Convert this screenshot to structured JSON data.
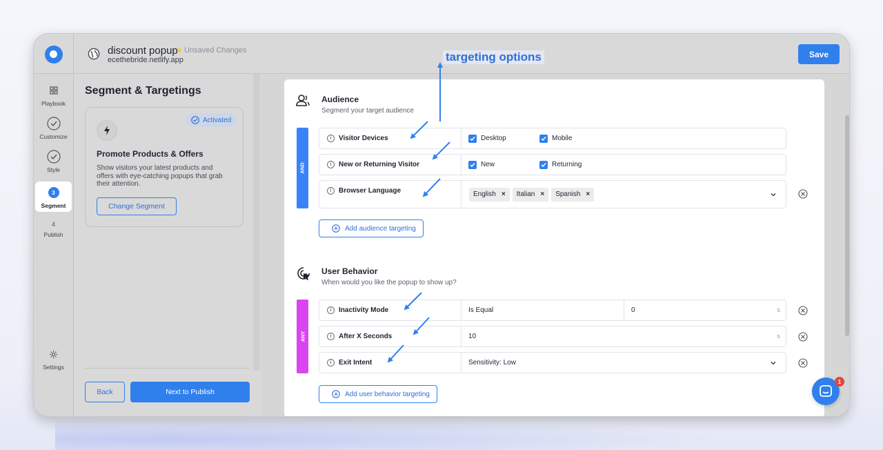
{
  "header": {
    "popup_name": "discount popup",
    "unsaved": "Unsaved Changes",
    "domain": "ecethebride.netlify.app",
    "save_label": "Save"
  },
  "nav": {
    "items": [
      {
        "label": "Playbook",
        "icon": "grid-icon"
      },
      {
        "label": "Customize",
        "icon": "check-circle-icon"
      },
      {
        "label": "Style",
        "icon": "check-circle-icon"
      },
      {
        "label": "Segment",
        "step": "3",
        "active": true
      },
      {
        "label": "Publish",
        "step": "4"
      }
    ],
    "settings_label": "Settings"
  },
  "panel": {
    "title": "Segment & Targetings",
    "badge": "Activated",
    "card_title": "Promote Products & Offers",
    "card_desc": "Show visitors your latest products and offers with eye-catching popups that grab their attention.",
    "change_label": "Change Segment",
    "back_label": "Back",
    "next_label": "Next to Publish"
  },
  "audience": {
    "title": "Audience",
    "subtitle": "Segment your target audience",
    "logic": "AND",
    "rows": [
      {
        "label": "Visitor Devices",
        "options": [
          "Desktop",
          "Mobile"
        ]
      },
      {
        "label": "New or Returning Visitor",
        "options": [
          "New",
          "Returning"
        ]
      },
      {
        "label": "Browser Language",
        "chips": [
          "English",
          "Italian",
          "Spanish"
        ]
      }
    ],
    "add_label": "Add audience targeting"
  },
  "behavior": {
    "title": "User Behavior",
    "subtitle": "When would you like the popup to show up?",
    "logic": "ANY",
    "rows": [
      {
        "label": "Inactivity Mode",
        "operator": "Is Equal",
        "value": "0",
        "unit": "s"
      },
      {
        "label": "After X Seconds",
        "value": "10",
        "unit": "s"
      },
      {
        "label": "Exit Intent",
        "value": "Sensitivity: Low"
      }
    ],
    "add_label": "Add user behavior targeting"
  },
  "annotation": "targeting options",
  "chat_badge": "1",
  "colors": {
    "accent": "#2f80ed",
    "and_bar": "#3b82f6",
    "any_bar": "#d946ef",
    "annotation": "#2f6fd6"
  }
}
